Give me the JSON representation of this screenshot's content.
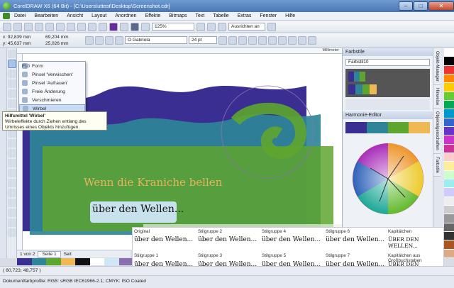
{
  "window": {
    "title": "CorelDRAW X6 (64 Bit) - [C:\\Users\\uttest\\Desktop\\Screenshot.cdr]",
    "min": "–",
    "max": "□",
    "close": "✕"
  },
  "menu": [
    "Datei",
    "Bearbeiten",
    "Ansicht",
    "Layout",
    "Anordnen",
    "Effekte",
    "Bitmaps",
    "Text",
    "Tabelle",
    "Extras",
    "Fenster",
    "Hilfe"
  ],
  "toolbar1": {
    "zoom": "125%",
    "snap": "Ausrichten an"
  },
  "toolbar2": {
    "x": "x: 92,839 mm",
    "y": "y: 45,637 mm",
    "w": "69,204 mm",
    "h": "25,026 mm",
    "font": "O  Gabriola",
    "size": "24 pt"
  },
  "ruler": {
    "unit": "Millimeter"
  },
  "flyout": {
    "items": [
      {
        "label": "Form",
        "shortcut": "F10"
      },
      {
        "label": "Pinsel 'Verwischen'",
        "shortcut": ""
      },
      {
        "label": "Pinsel 'Aufrauen'",
        "shortcut": ""
      },
      {
        "label": "Freie Änderung",
        "shortcut": ""
      },
      {
        "label": "Verschmieren",
        "shortcut": ""
      },
      {
        "label": "Wirbel",
        "shortcut": ""
      }
    ]
  },
  "tooltip": {
    "title": "Hilfsmittel 'Wirbel'",
    "text": "Wirbeleffekte durch Ziehen entlang des Umrisses eines Objekts hinzufügen."
  },
  "canvas": {
    "heading": "Wenn die Kraniche bellen",
    "selected_text": "über den Wellen..."
  },
  "panel": {
    "title": "Farbstile",
    "input_value": "Farbstil10",
    "harmony_title": "Harmonie-Editor",
    "harmony_colors": [
      "#3b2e93",
      "#2e8597",
      "#5ea52e",
      "#f0b755"
    ]
  },
  "vtabs": [
    "Objekt-Manager",
    "Hinweise",
    "Objekteigenschaften",
    "Farbstile"
  ],
  "styles": {
    "items": [
      {
        "label": "Original",
        "sample": "über den Wellen..."
      },
      {
        "label": "Stilgruppe 2",
        "sample": "über den Wellen..."
      },
      {
        "label": "Stilgruppe 4",
        "sample": "über den Wellen..."
      },
      {
        "label": "Stilgruppe 6",
        "sample": "über den Wellen..."
      },
      {
        "label": "Kapitälchen",
        "sample": "ÜBER DEN WELLEN..."
      },
      {
        "label": "Stilgruppe 1",
        "sample": "über den Wellen..."
      },
      {
        "label": "Stilgruppe 3",
        "sample": "über den Wellen..."
      },
      {
        "label": "Stilgruppe 5",
        "sample": "über den Wellen..."
      },
      {
        "label": "Stilgruppe 7",
        "sample": "über den Wellen..."
      },
      {
        "label": "Kapitälchen aus Großbuchstaben",
        "sample": "ÜBER DEN WELLEN..."
      }
    ]
  },
  "pages": {
    "counter": "1 von 2",
    "tab1": "Seite 1",
    "tab2": "Seit"
  },
  "status": {
    "coords": "( 60,723; 48,757 )",
    "profile": "Dokumentfarbprofile: RGB: sRGB IEC61966-2.1; CMYK: ISO Coated"
  },
  "palette_colors": [
    "#ffffff",
    "#000000",
    "#e33",
    "#f80",
    "#fc0",
    "#6c3",
    "#0a5",
    "#09c",
    "#36c",
    "#63c",
    "#c3c",
    "#c39",
    "#fcc",
    "#fe9",
    "#cfc",
    "#9ee",
    "#ccf",
    "#eee",
    "#ccc",
    "#999",
    "#666",
    "#333",
    "#a52",
    "#da8"
  ]
}
